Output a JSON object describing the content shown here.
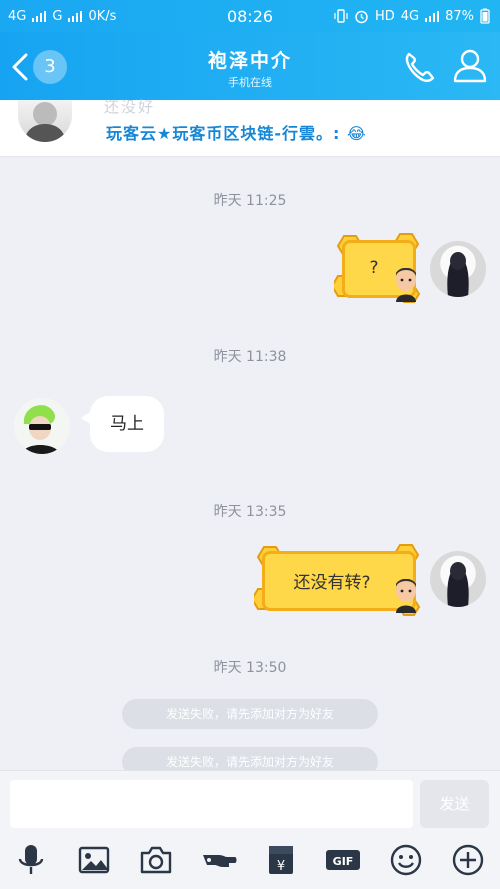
{
  "status": {
    "net1": "4G",
    "net2": "G",
    "speed": "0K/s",
    "time": "08:26",
    "hd": "HD",
    "net3": "4G",
    "battery": "87%"
  },
  "header": {
    "back_count": "3",
    "title": "袍泽中介",
    "subtitle": "手机在线"
  },
  "pinned": {
    "faded_text": "还没好",
    "text": "玩客云★玩客币区块链-行雲。:"
  },
  "messages": [
    {
      "timestamp": "昨天 11:25",
      "sticker_text": "?"
    },
    {
      "timestamp": "昨天 11:38",
      "text": "马上"
    },
    {
      "timestamp": "昨天 13:35",
      "sticker_text": "还没有转?"
    },
    {
      "timestamp": "昨天 13:50"
    }
  ],
  "system": [
    "发送失败，请先添加对方为好友",
    "发送失败，请先添加对方为好友"
  ],
  "input": {
    "send_label": "发送"
  },
  "colors": {
    "accent": "#1aa8f2",
    "sticker_fill": "#ffd84a",
    "sticker_border": "#f2ad18"
  },
  "toolbar_icons": [
    "microphone-icon",
    "image-icon",
    "camera-icon",
    "red-packet-icon",
    "gif-icon",
    "emoji-icon",
    "plus-icon"
  ]
}
